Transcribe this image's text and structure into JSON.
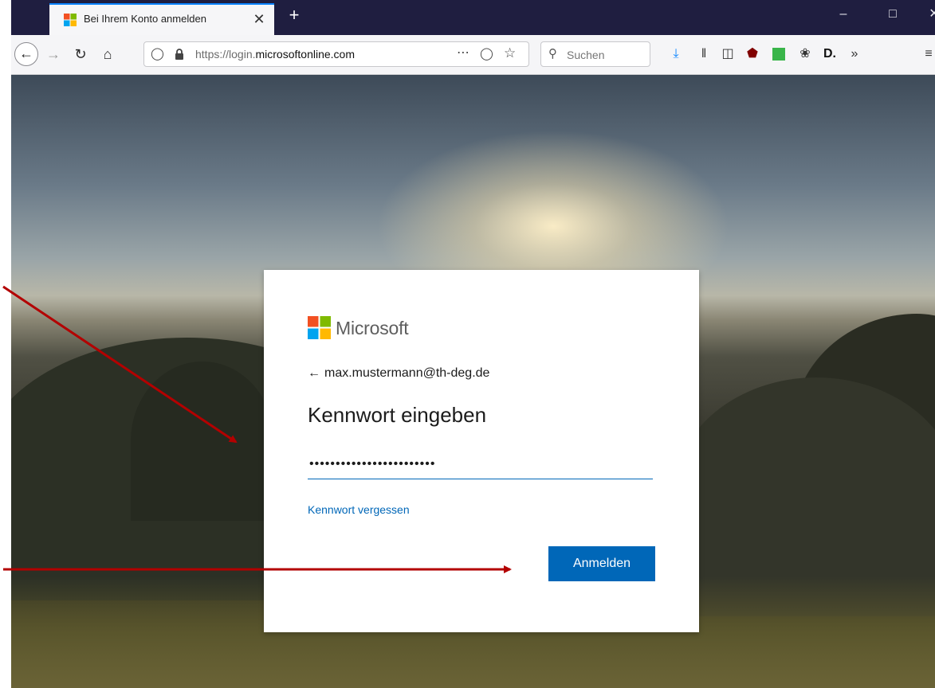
{
  "browser": {
    "tab_title": "Bei Ihrem Konto anmelden",
    "tab_close": "✕",
    "new_tab": "+",
    "url_prefix": "https://login.",
    "url_domain": "microsoftonline.com",
    "url_suffix": "",
    "search_placeholder": "Suchen",
    "window_min": "–",
    "window_max": "□",
    "window_close": "✕"
  },
  "signin": {
    "brand": "Microsoft",
    "back_arrow": "←",
    "account": "max.mustermann@th-deg.de",
    "heading": "Kennwort eingeben",
    "password_value": "••••••••••••••••••••••••",
    "forgot_link": "Kennwort vergessen",
    "submit_label": "Anmelden"
  },
  "colors": {
    "accent": "#0067b8",
    "annotation_arrow": "#b30000",
    "tabstrip": "#1f1e40"
  }
}
